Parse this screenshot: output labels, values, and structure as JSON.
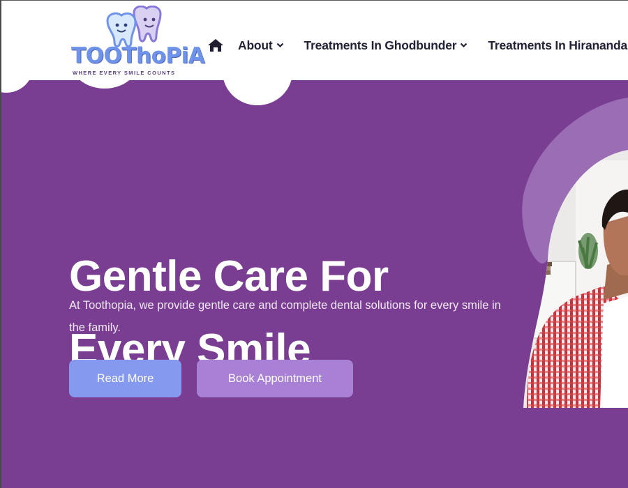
{
  "brand": {
    "name": "TOOThoPiA",
    "tagline": "WHERE EVERY SMILE COUNTS"
  },
  "nav": {
    "home_icon": "home-icon",
    "items": [
      {
        "label": "About",
        "icon": "chevron-down-icon"
      },
      {
        "label": "Treatments In Ghodbunder",
        "icon": "chevron-down-icon"
      },
      {
        "label": "Treatments In Hirananda"
      }
    ]
  },
  "hero": {
    "title_line1": "Gentle Care For",
    "title_line2": "Every Smile",
    "description": "At Toothopia, we provide gentle care and complete dental solutions for every smile in the family.",
    "read_more_label": "Read More",
    "book_label": "Book Appointment"
  },
  "colors": {
    "hero_bg": "#793e91",
    "nav_text": "#222236",
    "read_more_bg": "#8599ef",
    "book_bg": "#a880d6",
    "logo_text": "#6f93e8",
    "accent_shape": "#9a6db5"
  }
}
